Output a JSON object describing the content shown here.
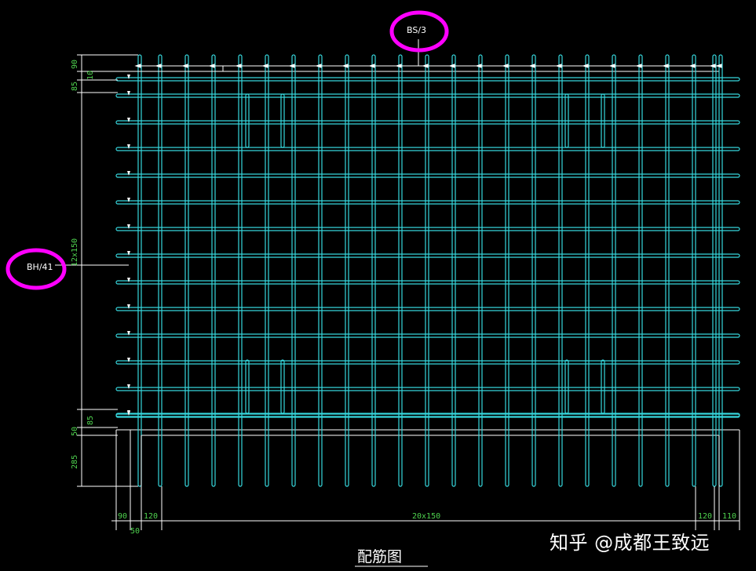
{
  "drawing": {
    "caption": "配筋图",
    "vertical_bar_tag": "BS/3",
    "horizontal_bar_tag": "BH/41",
    "highlight_color": "#ff00ff",
    "rebar_color": "#36d7dd",
    "dimension_color": "#4fd34f",
    "line_color": "#ffffff"
  },
  "dimensions": {
    "left": [
      "90",
      "10",
      "85",
      "12x150",
      "85",
      "50",
      "285"
    ],
    "bottom": [
      "90",
      "120",
      "20x150",
      "120",
      "110",
      "50"
    ]
  },
  "watermark": "知乎 @成都王致远"
}
